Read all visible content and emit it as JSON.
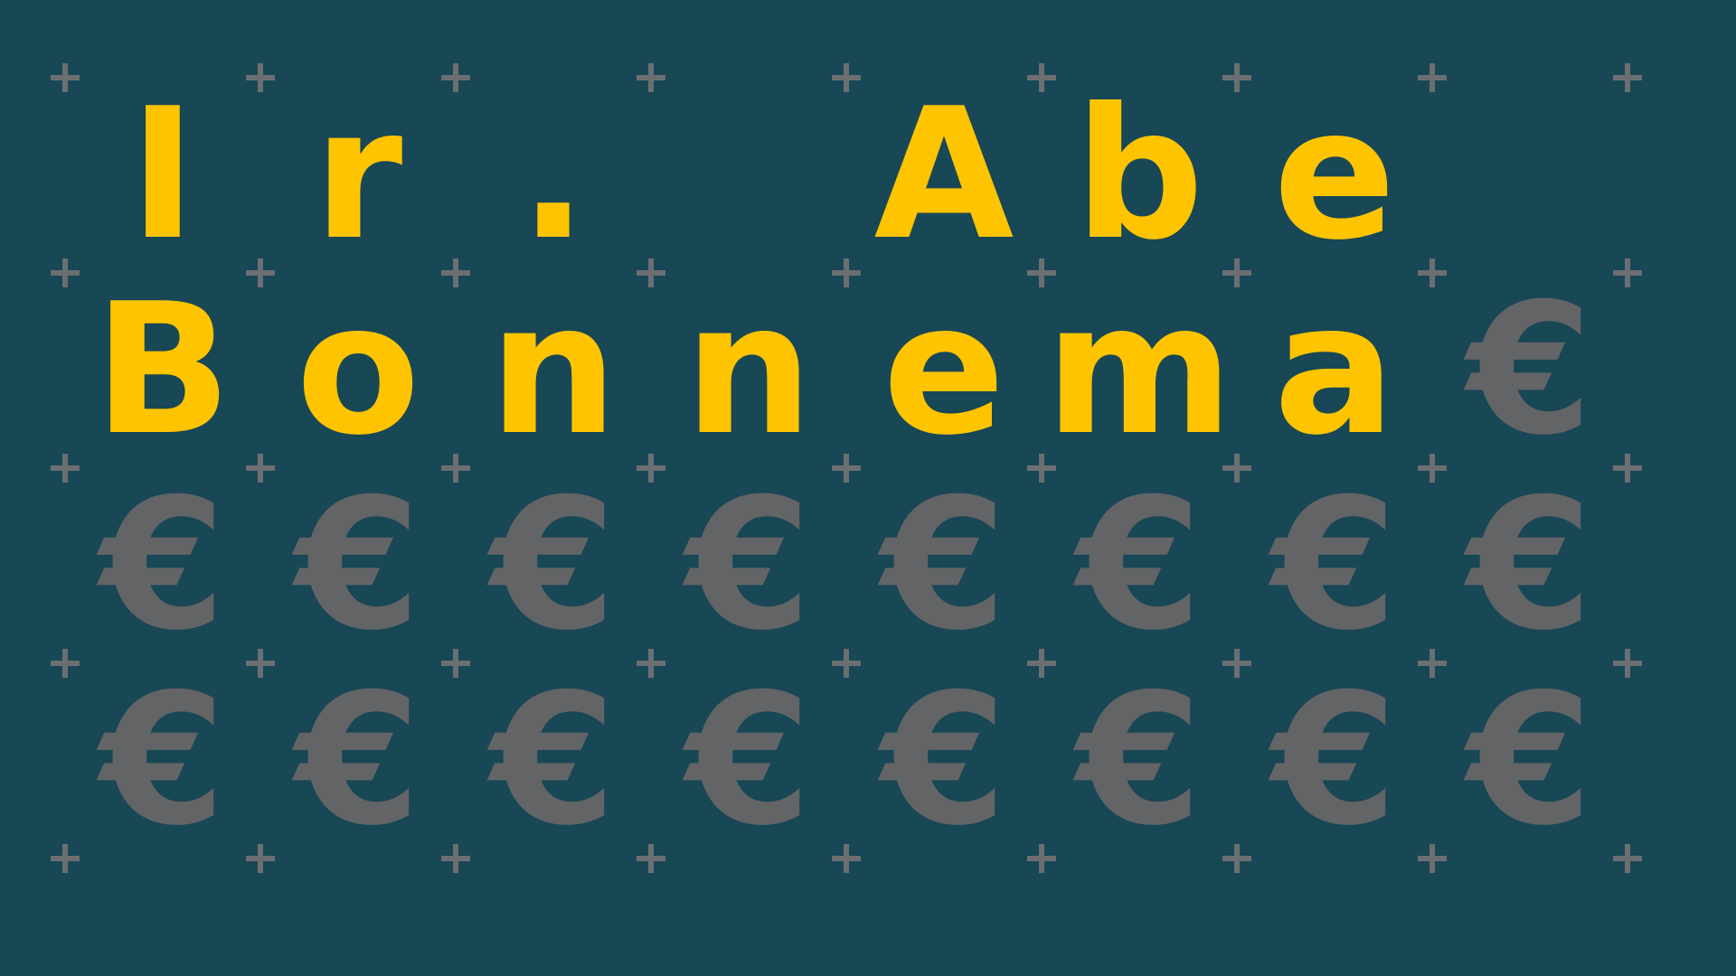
{
  "colors": {
    "background": "#184755",
    "letter": "#ffc400",
    "euro": "#636466",
    "plus": "#6b6f72"
  },
  "board": {
    "cells": [
      [
        "I",
        "r",
        ".",
        "",
        "A",
        "b",
        "e",
        "",
        ""
      ],
      [
        "B",
        "o",
        "n",
        "n",
        "e",
        "m",
        "a",
        "€",
        ""
      ],
      [
        "€",
        "€",
        "€",
        "€",
        "€",
        "€",
        "€",
        "€",
        ""
      ],
      [
        "€",
        "€",
        "€",
        "€",
        "€",
        "€",
        "€",
        "€",
        ""
      ]
    ]
  }
}
